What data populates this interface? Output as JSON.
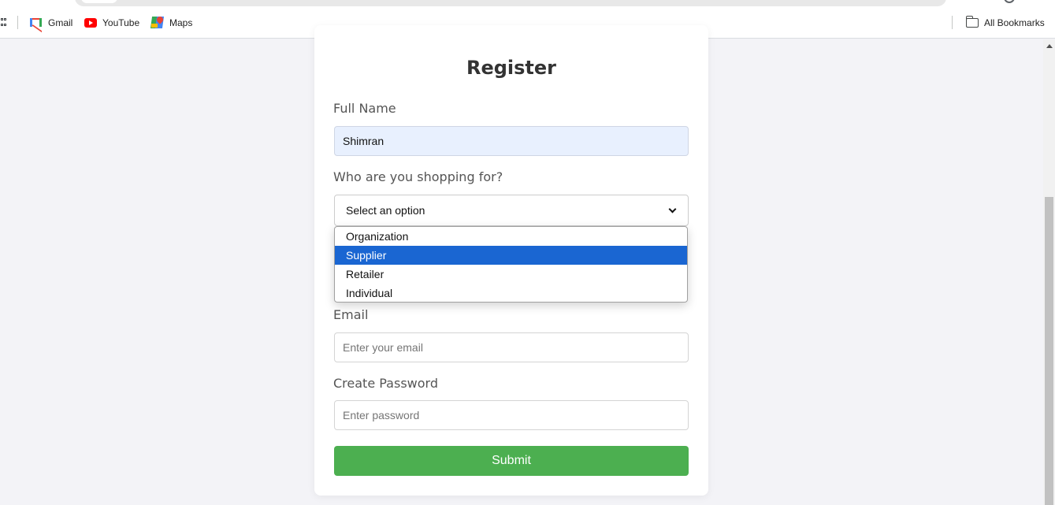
{
  "bookmarks": {
    "items": [
      {
        "label": "Gmail",
        "icon": "gmail-icon"
      },
      {
        "label": "YouTube",
        "icon": "youtube-icon"
      },
      {
        "label": "Maps",
        "icon": "maps-icon"
      }
    ],
    "all_bookmarks": "All Bookmarks"
  },
  "form": {
    "title": "Register",
    "full_name_label": "Full Name",
    "full_name_value": "Shimran",
    "shopping_label": "Who are you shopping for?",
    "shopping_selected": "Select an option",
    "shopping_options": [
      "Organization",
      "Supplier",
      "Retailer",
      "Individual"
    ],
    "highlighted_option": "Supplier",
    "email_label": "Email",
    "email_placeholder": "Enter your email",
    "password_label": "Create Password",
    "password_placeholder": "Enter password",
    "submit_label": "Submit"
  },
  "colors": {
    "accent_green": "#4caf50",
    "option_highlight": "#1a66d2",
    "page_background": "#f3f3f7"
  }
}
